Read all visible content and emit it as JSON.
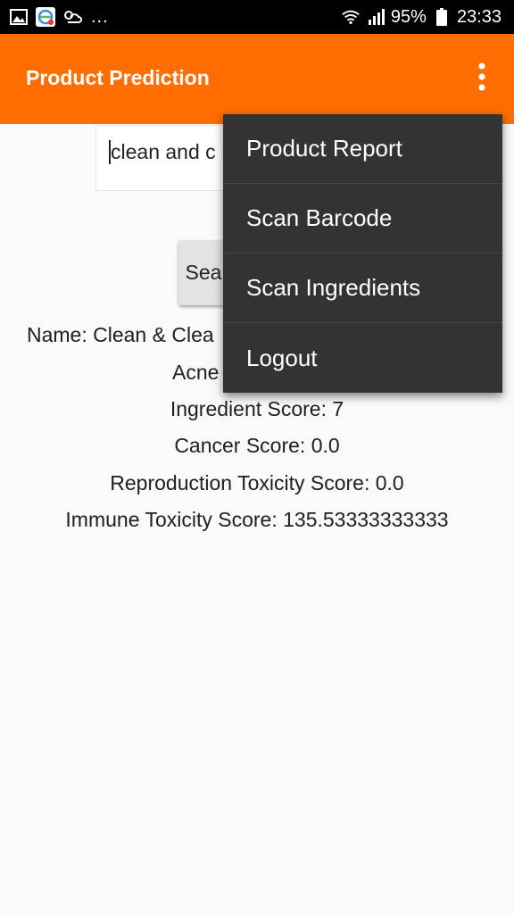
{
  "status_bar": {
    "battery": "95%",
    "time": "23:33",
    "more_notifications": "...",
    "icons": [
      "gallery-icon",
      "app-notification-icon",
      "weather-icon",
      "wifi-icon",
      "signal-icon",
      "battery-icon"
    ]
  },
  "app_bar": {
    "title": "Product Prediction",
    "overflow_icon": "more-vert-icon",
    "background": "#ff6d00"
  },
  "search": {
    "value": "clean and c",
    "button_label": "Sea"
  },
  "results": {
    "name": "Name: Clean & Clea",
    "acne": "Acne",
    "ingredient_score": "Ingredient Score:  7",
    "cancer_score": "Cancer Score:  0.0",
    "reproduction_toxicity_score": "Reproduction Toxicity Score: 0.0",
    "immune_toxicity_score": "Immune Toxicity Score:  135.53333333333"
  },
  "menu": {
    "items": [
      "Product Report",
      "Scan Barcode",
      "Scan Ingredients",
      "Logout"
    ],
    "background": "#333333"
  }
}
